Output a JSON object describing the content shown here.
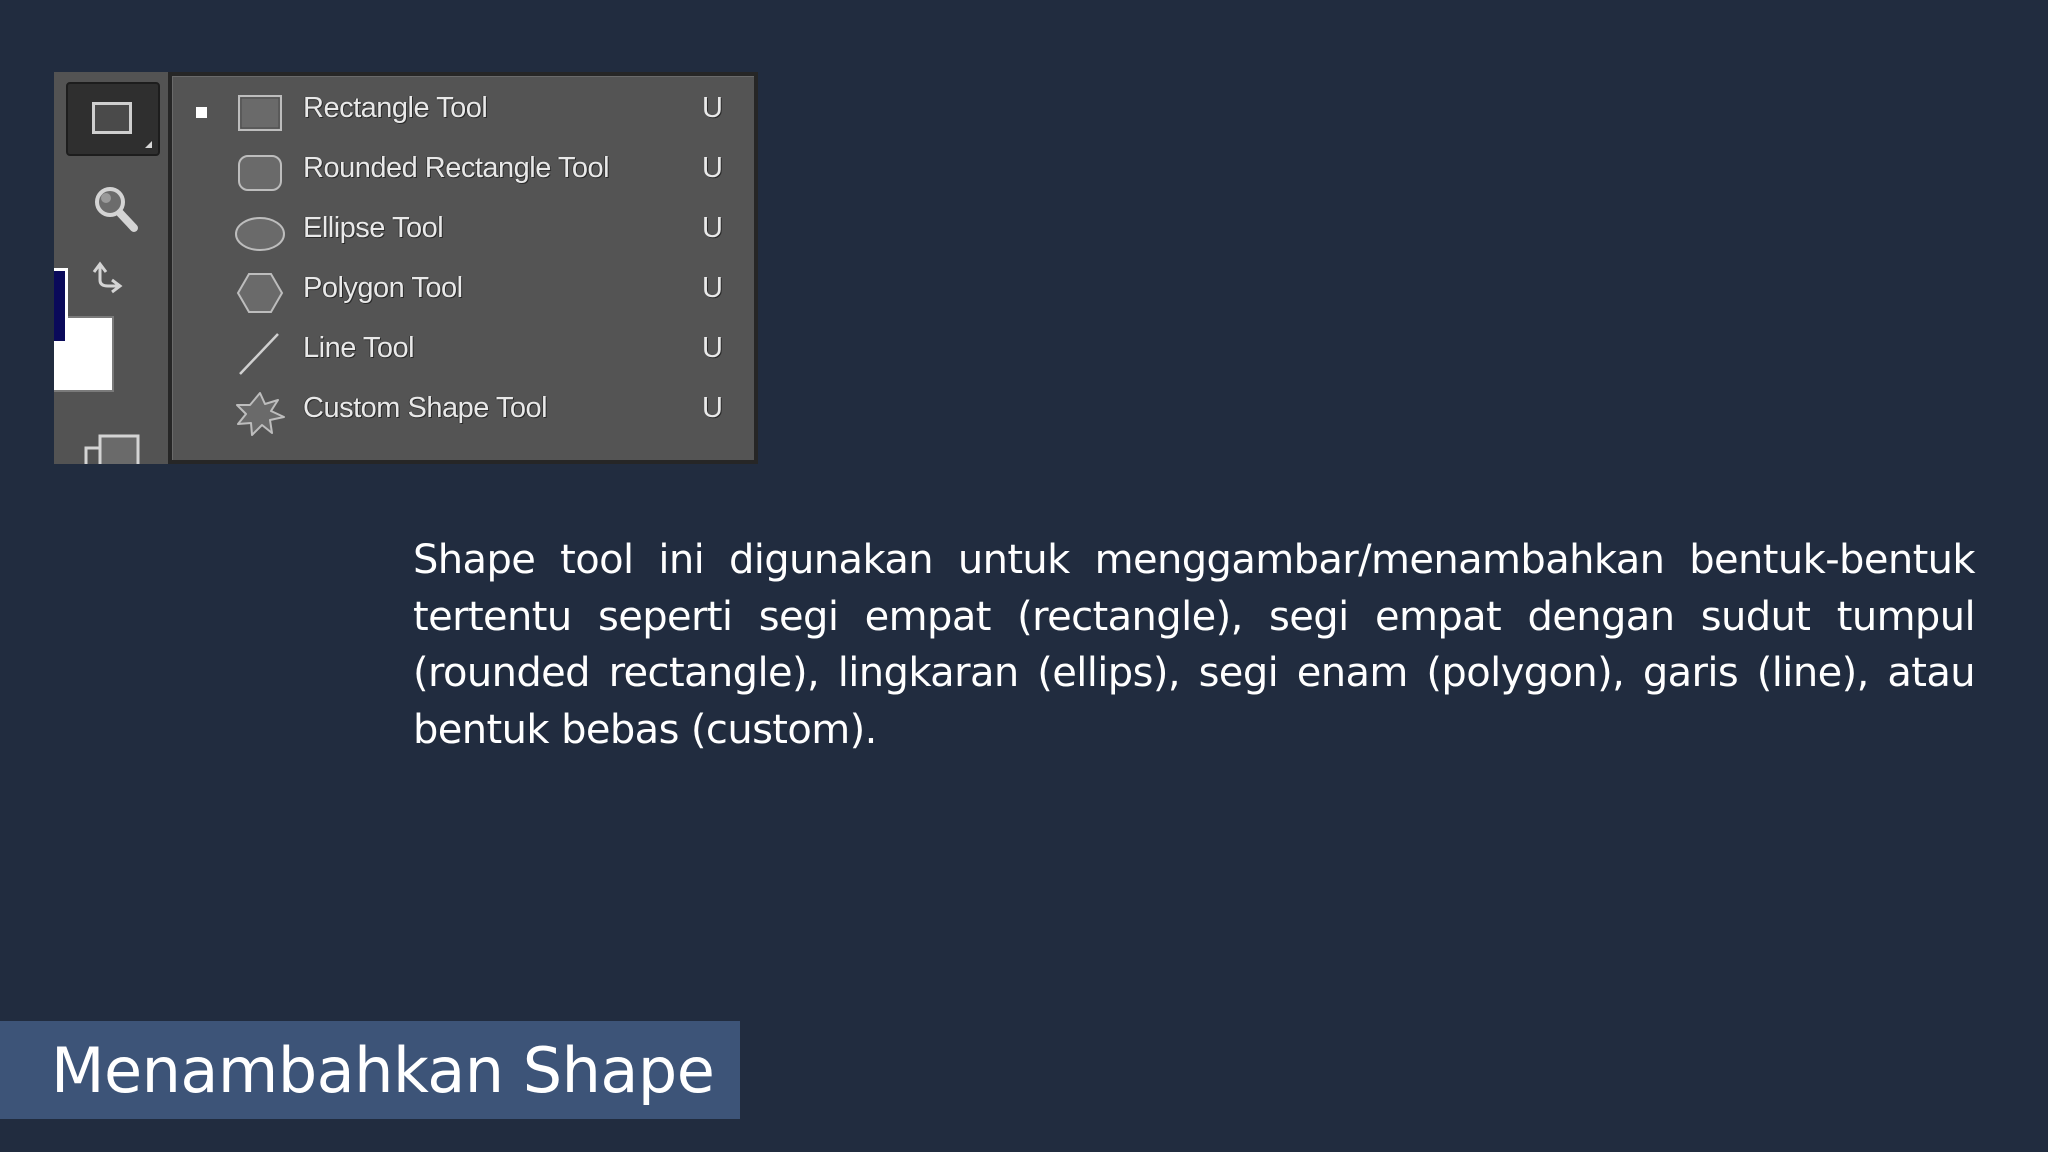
{
  "slide": {
    "title": "Menambahkan Shape",
    "description": "Shape tool ini digunakan untuk menggambar/menambahkan bentuk-bentuk tertentu seperti segi empat (rectangle), segi empat dengan sudut tumpul (rounded rectangle), lingkaran (ellips), segi enam (polygon), garis (line), atau bentuk bebas (custom).",
    "colors": {
      "background": "#212c3f",
      "title_bar": "#3d5478",
      "text": "#ffffff"
    }
  },
  "toolbar": {
    "active_tool_icon": "rectangle-tool-icon",
    "icons": [
      "rectangle-tool-icon",
      "zoom-icon",
      "swap-colors-icon",
      "quick-mask-icon"
    ],
    "colors": {
      "panel": "#535353",
      "foreground_swatch": "#0a0a5a",
      "background_swatch": "#ffffff"
    }
  },
  "flyout": {
    "items": [
      {
        "label": "Rectangle Tool",
        "shortcut": "U",
        "icon": "rectangle-icon",
        "selected": true
      },
      {
        "label": "Rounded Rectangle Tool",
        "shortcut": "U",
        "icon": "rounded-rectangle-icon",
        "selected": false
      },
      {
        "label": "Ellipse Tool",
        "shortcut": "U",
        "icon": "ellipse-icon",
        "selected": false
      },
      {
        "label": "Polygon Tool",
        "shortcut": "U",
        "icon": "polygon-icon",
        "selected": false
      },
      {
        "label": "Line Tool",
        "shortcut": "U",
        "icon": "line-icon",
        "selected": false
      },
      {
        "label": "Custom Shape Tool",
        "shortcut": "U",
        "icon": "custom-shape-icon",
        "selected": false
      }
    ]
  }
}
